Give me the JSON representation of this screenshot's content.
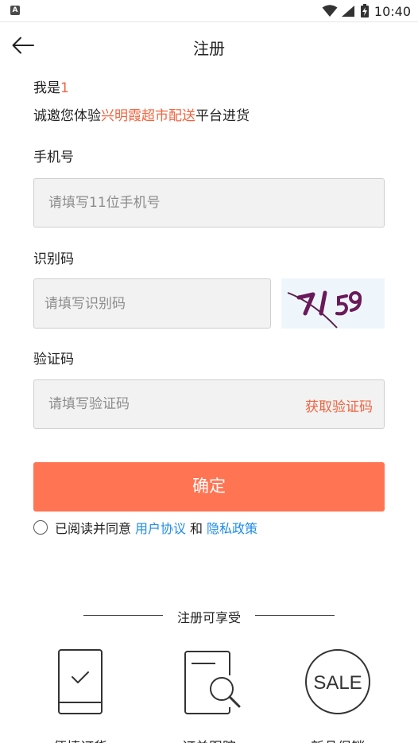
{
  "status_bar": {
    "app_icon_letter": "A",
    "time": "10:40"
  },
  "header": {
    "title": "注册"
  },
  "intro": {
    "line1_prefix": "我是",
    "line1_value": "1",
    "line2_prefix": "诚邀您体验",
    "line2_brand": "兴明霞超市配送",
    "line2_suffix": "平台进货"
  },
  "phone": {
    "label": "手机号",
    "placeholder": "请填写11位手机号",
    "value": ""
  },
  "captcha": {
    "label": "识别码",
    "placeholder": "请填写识别码",
    "value": "",
    "image_text": "7159"
  },
  "verify": {
    "label": "验证码",
    "placeholder": "请填写验证码",
    "value": "",
    "get_code_label": "获取验证码"
  },
  "confirm_label": "确定",
  "agreement": {
    "prefix": "已阅读并同意",
    "user_agreement": "用户协议",
    "and": "和",
    "privacy_policy": "隐私政策"
  },
  "benefits": {
    "title": "注册可享受",
    "items": [
      {
        "label": "便捷订货",
        "icon": "tablet-check-icon"
      },
      {
        "label": "订单跟踪",
        "icon": "document-search-icon"
      },
      {
        "label": "新品促销",
        "icon": "sale-badge-icon"
      }
    ]
  },
  "colors": {
    "accent": "#f0643f",
    "button": "#ff7452",
    "link": "#1f8ce6"
  }
}
